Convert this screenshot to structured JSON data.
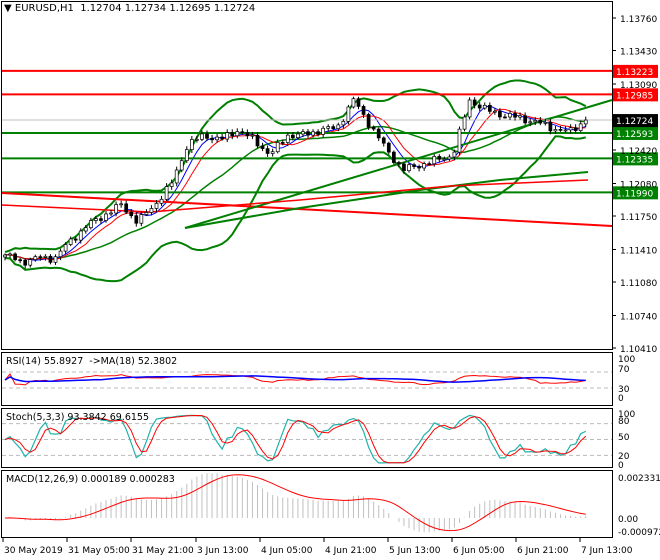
{
  "chart_data": {
    "type": "candlestick",
    "symbol": "EURUSD",
    "timeframe": "H1",
    "header": {
      "title": "EURUSD,H1",
      "open": "1.12704",
      "high": "1.12734",
      "low": "1.12695",
      "close": "1.12724"
    },
    "price_axis": {
      "ticks": [
        "1.13760",
        "1.13430",
        "1.13090",
        "1.12420",
        "1.12080",
        "1.11750",
        "1.11410",
        "1.11080",
        "1.10740",
        "1.10410"
      ],
      "range": [
        1.1041,
        1.1376
      ]
    },
    "current_price": "1.12724",
    "levels": [
      {
        "value": "1.13223",
        "color": "#ff0000"
      },
      {
        "value": "1.12985",
        "color": "#ff0000"
      },
      {
        "value": "1.12593",
        "color": "#008000"
      },
      {
        "value": "1.12335",
        "color": "#008000"
      },
      {
        "value": "1.11990",
        "color": "#008000"
      }
    ],
    "time_labels": [
      "30 May 2019",
      "31 May 05:00",
      "31 May 21:00",
      "3 Jun 13:00",
      "4 Jun 05:00",
      "4 Jun 21:00",
      "5 Jun 13:00",
      "6 Jun 05:00",
      "6 Jun 21:00",
      "7 Jun 13:00"
    ],
    "close_anchors": [
      1.11354,
      1.11283,
      1.11324,
      1.11324,
      1.11507,
      1.11659,
      1.1176,
      1.11862,
      1.11689,
      1.11862,
      1.12065,
      1.12471,
      1.12572,
      1.12522,
      1.12623,
      1.12522,
      1.1237,
      1.12572,
      1.12572,
      1.12623,
      1.12643,
      1.12928,
      1.12674,
      1.1242,
      1.12217,
      1.12268,
      1.12319,
      1.1237,
      1.12928,
      1.12826,
      1.12776,
      1.12745,
      1.12704,
      1.12643,
      1.12603,
      1.12724
    ],
    "indicators": {
      "rsi": {
        "label": "RSI(14) 55.8927  ->MA(18) 52.3802",
        "ticks": [
          "100",
          "70",
          "30",
          "0"
        ]
      },
      "stoch": {
        "label": "Stoch(5,3,3) 93.3842 69.6155",
        "ticks": [
          "100",
          "80",
          "50",
          "20",
          "0"
        ]
      },
      "macd": {
        "label": "MACD(12,26,9) 0.000189 0.000283",
        "ticks": [
          "0.002331",
          "0.00",
          "-0.000972"
        ]
      }
    },
    "colors": {
      "bull_band": "#008000",
      "resistance": "#ff0000",
      "rsi": "#ff0000",
      "rsi_ma": "#0000ff",
      "stoch_k": "#20b2aa",
      "stoch_d": "#ff0000",
      "macd_hist": "#c0c0c0",
      "macd_signal": "#ff0000"
    }
  }
}
